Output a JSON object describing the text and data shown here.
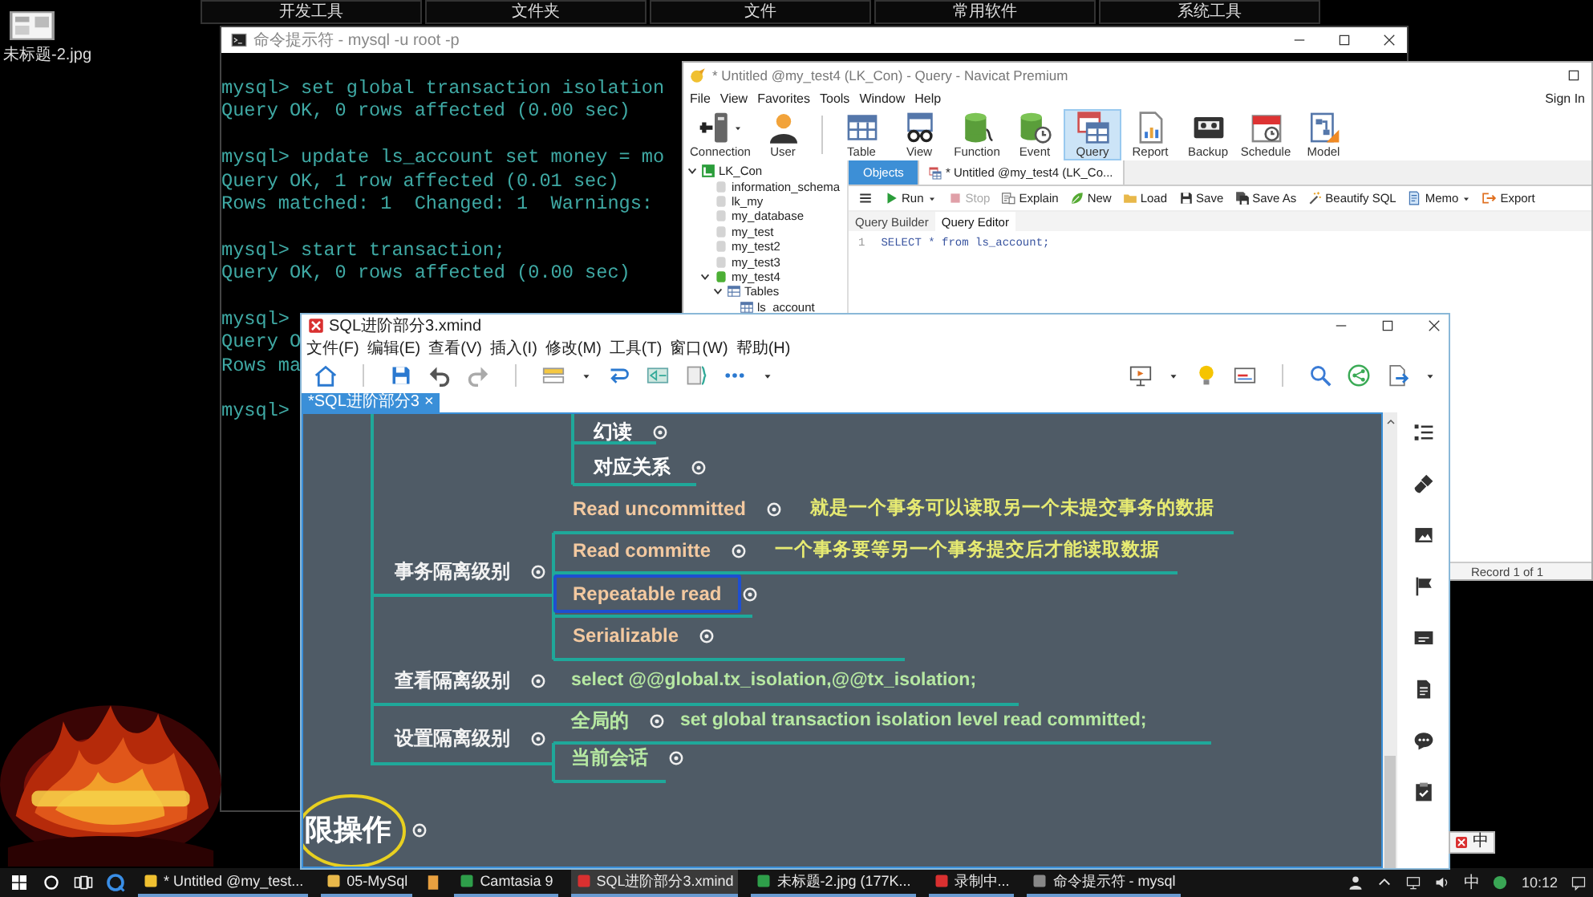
{
  "desktop": {
    "dock_tabs": [
      "开发工具",
      "文件夹",
      "文件",
      "常用软件",
      "系统工具"
    ],
    "icon_label": "未标题-2.jpg"
  },
  "cmd": {
    "title": "命令提示符 - mysql -u root -p",
    "blocks": [
      [
        "mysql> set global transaction isolation",
        "Query OK, 0 rows affected (0.00 sec)"
      ],
      [
        "mysql> update ls_account set money = mo",
        "Query OK, 1 row affected (0.01 sec)",
        "Rows matched: 1  Changed: 1  Warnings:"
      ],
      [
        "mysql> start transaction;",
        "Query OK, 0 rows affected (0.00 sec)"
      ],
      [
        "mysql>",
        "Query O",
        "Rows ma"
      ],
      [
        "mysql>"
      ]
    ]
  },
  "navicat": {
    "title": "* Untitled @my_test4 (LK_Con) - Query - Navicat Premium",
    "menu": [
      "File",
      "View",
      "Favorites",
      "Tools",
      "Window",
      "Help"
    ],
    "sign_in": "Sign In",
    "toolbar": [
      {
        "label": "Connection",
        "selected": false,
        "dropdown": true
      },
      {
        "label": "User",
        "selected": false,
        "dropdown": false
      },
      {
        "label": "Table",
        "selected": false,
        "dropdown": false
      },
      {
        "label": "View",
        "selected": false,
        "dropdown": false
      },
      {
        "label": "Function",
        "selected": false,
        "dropdown": false
      },
      {
        "label": "Event",
        "selected": false,
        "dropdown": false
      },
      {
        "label": "Query",
        "selected": true,
        "dropdown": false
      },
      {
        "label": "Report",
        "selected": false,
        "dropdown": false
      },
      {
        "label": "Backup",
        "selected": false,
        "dropdown": false
      },
      {
        "label": "Schedule",
        "selected": false,
        "dropdown": false
      },
      {
        "label": "Model",
        "selected": false,
        "dropdown": false
      }
    ],
    "tree": [
      {
        "label": "LK_Con",
        "expanded": true,
        "children": [
          {
            "label": "information_schema"
          },
          {
            "label": "lk_my"
          },
          {
            "label": "my_database"
          },
          {
            "label": "my_test"
          },
          {
            "label": "my_test2"
          },
          {
            "label": "my_test3"
          },
          {
            "label": "my_test4",
            "expanded": true,
            "children": [
              {
                "label": "Tables",
                "expanded": true,
                "children": [
                  {
                    "label": "ls_account"
                  }
                ]
              }
            ]
          }
        ]
      }
    ],
    "tabs": [
      {
        "label": "Objects",
        "selected": true
      },
      {
        "label": "* Untitled @my_test4 (LK_Co...",
        "selected": false
      }
    ],
    "actions": [
      {
        "label": "Run",
        "disabled": false,
        "dropdown": true
      },
      {
        "label": "Stop",
        "disabled": true,
        "dropdown": false
      },
      {
        "label": "Explain",
        "disabled": false,
        "dropdown": false
      },
      {
        "label": "New",
        "disabled": false,
        "dropdown": false
      },
      {
        "label": "Load",
        "disabled": false,
        "dropdown": false
      },
      {
        "label": "Save",
        "disabled": false,
        "dropdown": false
      },
      {
        "label": "Save As",
        "disabled": false,
        "dropdown": false
      },
      {
        "label": "Beautify SQL",
        "disabled": false,
        "dropdown": false
      },
      {
        "label": "Memo",
        "disabled": false,
        "dropdown": true
      },
      {
        "label": "Export",
        "disabled": false,
        "dropdown": false
      }
    ],
    "editor_tabs": [
      {
        "label": "Query Builder",
        "selected": false
      },
      {
        "label": "Query Editor",
        "selected": true
      }
    ],
    "editor": {
      "line_number": "1",
      "code": "SELECT * from ls_account;"
    },
    "status": "Record 1 of 1"
  },
  "xmind": {
    "title": "SQL进阶部分3.xmind",
    "menu": [
      "文件(F)",
      "编辑(E)",
      "查看(V)",
      "插入(I)",
      "修改(M)",
      "工具(T)",
      "窗口(W)",
      "帮助(H)"
    ],
    "tab": "*SQL进阶部分3",
    "tab_close": "×",
    "nodes": [
      {
        "text": "幻读",
        "kind": "topic",
        "color": "#ffffff",
        "selected": false
      },
      {
        "text": "对应关系",
        "kind": "topic",
        "color": "#ffffff",
        "selected": false
      },
      {
        "text": "Read uncommitted",
        "kind": "topic",
        "color": "#f3c9a0",
        "selected": false
      },
      {
        "text": "就是一个事务可以读取另一个未提交事务的数据",
        "kind": "note",
        "color": "#e6ea72",
        "selected": false
      },
      {
        "text": "Read committe",
        "kind": "topic",
        "color": "#f3c9a0",
        "selected": false
      },
      {
        "text": "一个事务要等另一个事务提交后才能读取数据",
        "kind": "note",
        "color": "#e6ea72",
        "selected": false
      },
      {
        "text": "Repeatable read",
        "kind": "topic",
        "color": "#f3c9a0",
        "selected": true
      },
      {
        "text": "Serializable",
        "kind": "topic",
        "color": "#f3c9a0",
        "selected": false
      },
      {
        "text": "事务隔离级别",
        "kind": "topic",
        "color": "#f2f2f2",
        "selected": false
      },
      {
        "text": "查看隔离级别",
        "kind": "topic",
        "color": "#f2f2f2",
        "selected": false
      },
      {
        "text": "select @@global.tx_isolation,@@tx_isolation;",
        "kind": "note",
        "color": "#b6e8a2",
        "selected": false
      },
      {
        "text": "设置隔离级别",
        "kind": "topic",
        "color": "#f2f2f2",
        "selected": false
      },
      {
        "text": "全局的",
        "kind": "topic",
        "color": "#b6e8a2",
        "selected": false
      },
      {
        "text": "set global transaction isolation level read committed;",
        "kind": "note",
        "color": "#b6e8a2",
        "selected": false
      },
      {
        "text": "当前会话",
        "kind": "topic",
        "color": "#b6e8a2",
        "selected": false
      },
      {
        "text": "限操作",
        "kind": "main",
        "color": "#ffffff",
        "selected": false
      }
    ]
  },
  "taskbar": {
    "items": [
      {
        "label": "* Untitled @my_test...",
        "selected": false
      },
      {
        "label": "05-MySql",
        "selected": false
      },
      {
        "label": "Camtasia 9",
        "selected": false
      },
      {
        "label": "SQL进阶部分3.xmind",
        "selected": true
      },
      {
        "label": "未标题-2.jpg (177K...",
        "selected": false
      },
      {
        "label": "录制中...",
        "selected": false
      },
      {
        "label": "命令提示符 - mysql",
        "selected": false
      }
    ],
    "ime": "中",
    "clock": "10:12"
  },
  "ime_bar": "中"
}
